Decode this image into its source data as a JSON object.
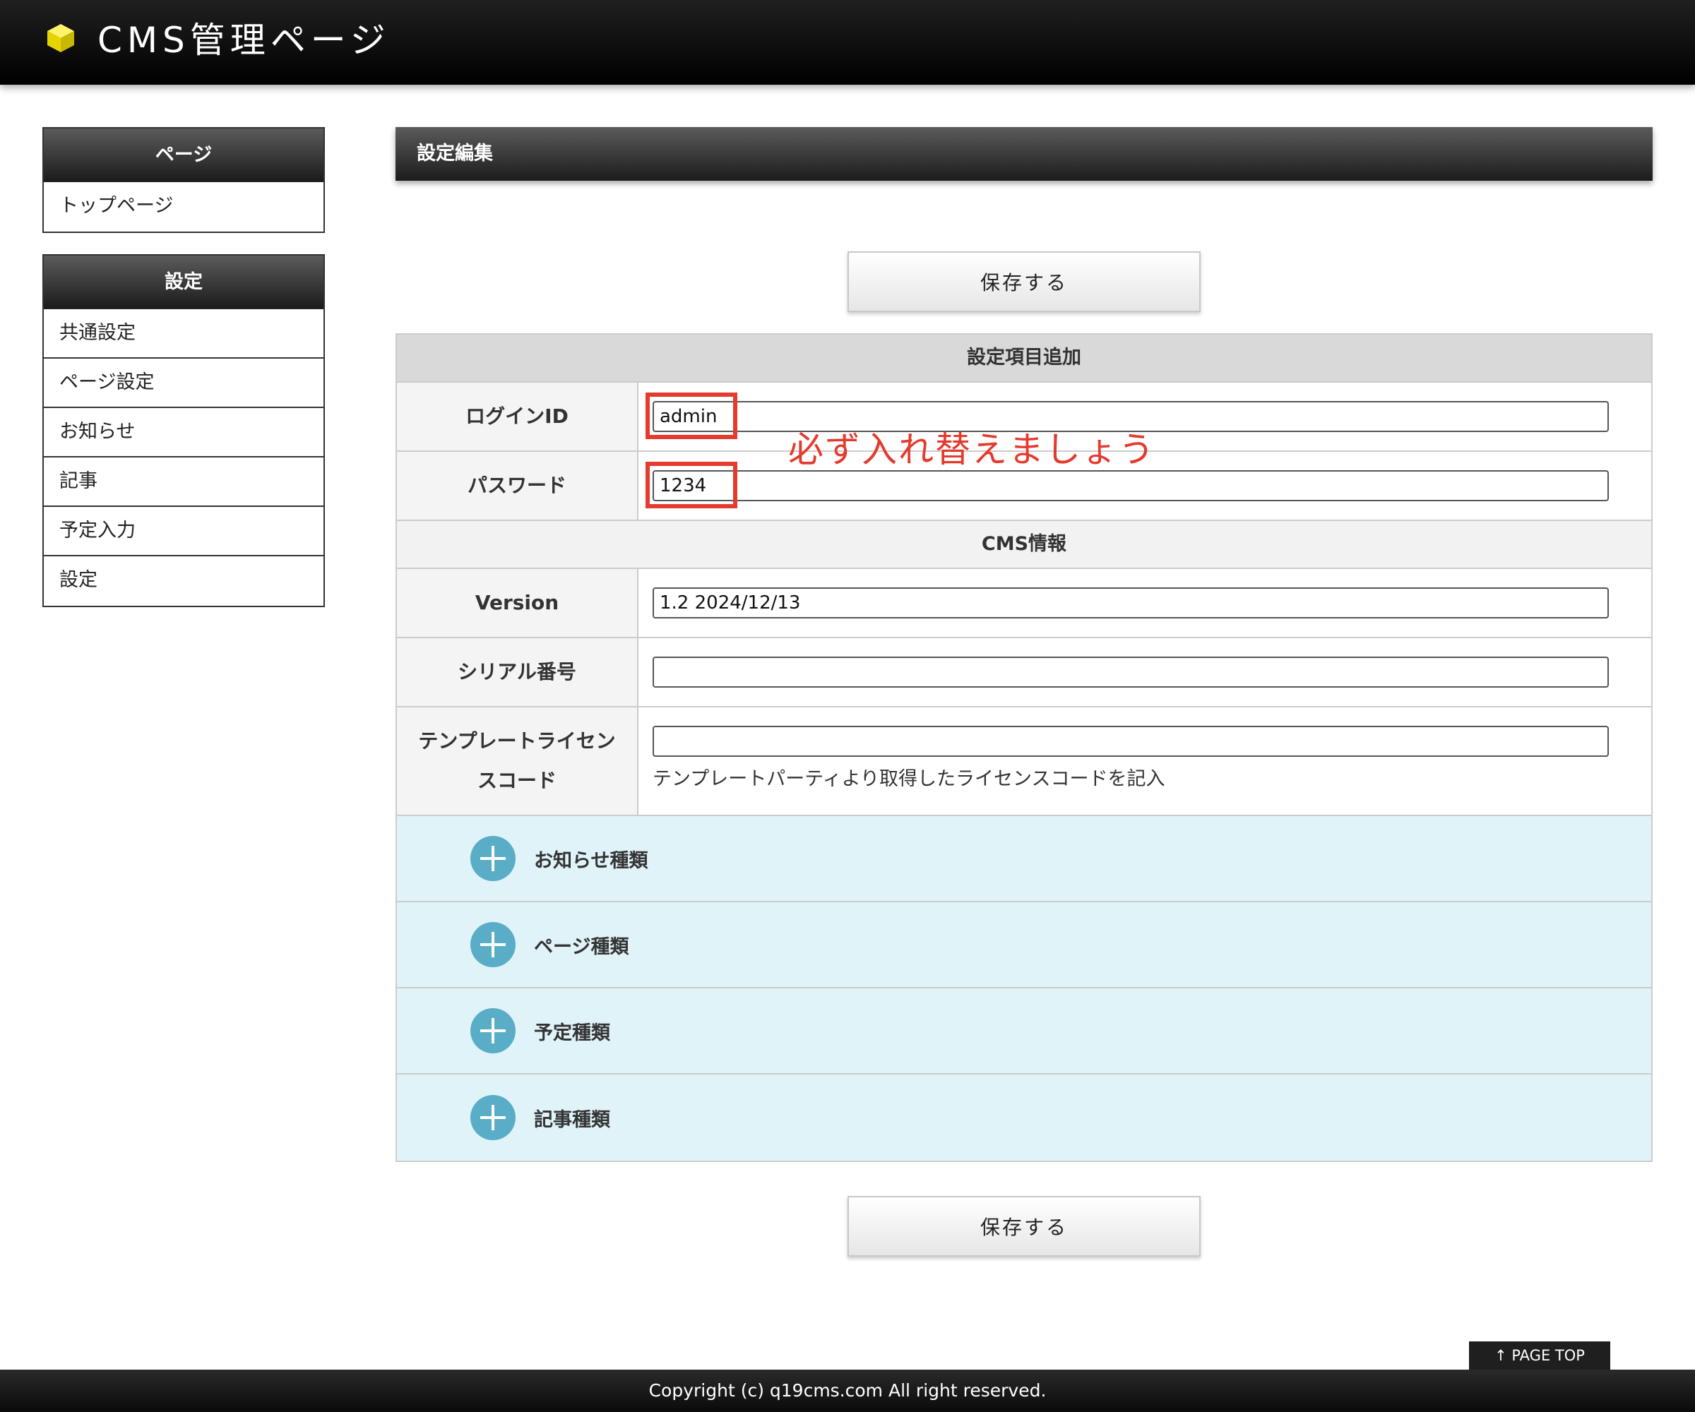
{
  "header": {
    "title": "CMS管理ページ"
  },
  "sidebar": {
    "groups": [
      {
        "heading": "ページ",
        "items": [
          "トップページ"
        ]
      },
      {
        "heading": "設定",
        "items": [
          "共通設定",
          "ページ設定",
          "お知らせ",
          "記事",
          "予定入力",
          "設定"
        ]
      }
    ]
  },
  "main": {
    "heading": "設定編集",
    "save_label": "保存する",
    "section_add": "設定項目追加",
    "section_info": "CMS情報",
    "fields": {
      "login_id": {
        "label": "ログインID",
        "value": "admin"
      },
      "password": {
        "label": "パスワード",
        "value": "1234"
      },
      "version": {
        "label": "Version",
        "value": "1.2 2024/12/13"
      },
      "serial": {
        "label": "シリアル番号",
        "value": ""
      },
      "license": {
        "label_line1": "テンプレートライセン",
        "label_line2": "スコード",
        "value": "",
        "hint": "テンプレートパーティより取得したライセンスコードを記入"
      }
    },
    "accordion": [
      "お知らせ種類",
      "ページ種類",
      "予定種類",
      "記事種類"
    ]
  },
  "annotation": {
    "text": "必ず入れ替えましょう",
    "color": "#e53a2e"
  },
  "footer": {
    "page_top": "↑ PAGE TOP",
    "copyright": "Copyright (c) q19cms.com All right reserved."
  },
  "colors": {
    "header_bg": "#000000",
    "accordion_bg": "#dff3f9",
    "plus_icon": "#5aadc7",
    "highlight_red": "#e53a2e"
  }
}
